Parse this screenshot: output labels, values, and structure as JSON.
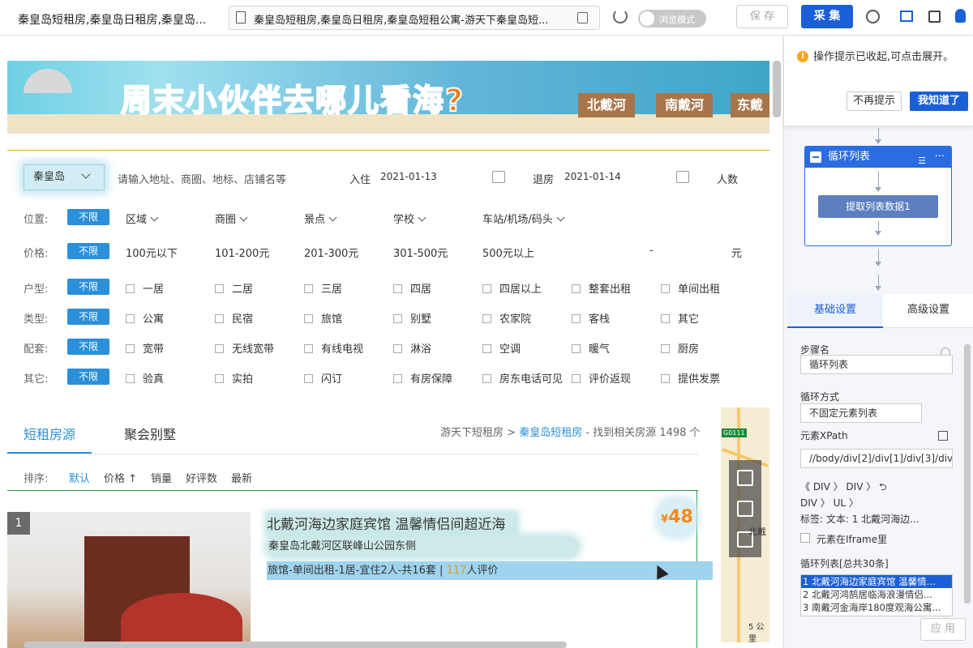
{
  "browser": {
    "tab_title": "秦皇岛短租房,秦皇岛日租房,秦皇岛...",
    "url": "秦皇岛短租房,秦皇岛日租房,秦皇岛短租公寓-游天下秦皇岛短...",
    "browse_mode_label": "浏览模式",
    "save_label": "保 存",
    "collect_label": "采 集"
  },
  "banner": {
    "slogan": "周末小伙伴去哪儿看海?",
    "tags": [
      "北戴河",
      "南戴河",
      "东戴"
    ]
  },
  "search": {
    "city": "秦皇岛",
    "placeholder": "请输入地址、商圈、地标、店铺名等",
    "checkin_label": "入住",
    "checkin_value": "2021-01-13",
    "checkout_label": "退房",
    "checkout_value": "2021-01-14",
    "people_label": "人数"
  },
  "filters": {
    "nolimit": "不限",
    "location": {
      "label": "位置:",
      "opts": [
        "区域",
        "商圈",
        "景点",
        "学校",
        "车站/机场/码头"
      ]
    },
    "price": {
      "label": "价格:",
      "opts": [
        "100元以下",
        "101-200元",
        "201-300元",
        "301-500元",
        "500元以上",
        "-",
        "元"
      ]
    },
    "room": {
      "label": "户型:",
      "opts": [
        "一居",
        "二居",
        "三居",
        "四居",
        "四居以上",
        "整套出租",
        "单间出租"
      ]
    },
    "type": {
      "label": "类型:",
      "opts": [
        "公寓",
        "民宿",
        "旅馆",
        "别墅",
        "农家院",
        "客栈",
        "其它"
      ]
    },
    "facility": {
      "label": "配套:",
      "opts": [
        "宽带",
        "无线宽带",
        "有线电视",
        "淋浴",
        "空调",
        "暖气",
        "厨房"
      ]
    },
    "other": {
      "label": "其它:",
      "opts": [
        "验真",
        "实拍",
        "闪订",
        "有房保障",
        "房东电话可见",
        "评价返现",
        "提供发票"
      ]
    }
  },
  "results": {
    "tab_active": "短租房源",
    "tab_other": "聚会别墅",
    "crumb_home": "游天下短租房",
    "crumb_sep": ">",
    "crumb_city": "秦皇岛短租房",
    "crumb_count": "- 找到相关房源 1498 个",
    "sort_label": "排序:",
    "sort_opts": [
      "默认",
      "价格 ↑",
      "销量",
      "好评数",
      "最新"
    ]
  },
  "listing": {
    "index": "1",
    "title": "北戴河海边家庭宾馆 温馨情侣间超近海",
    "address": "秦皇岛北戴河区联峰山公园东侧",
    "meta_text": "旅馆-单间出租-1居-宜住2人-共16套 |",
    "reviews_count": "117",
    "reviews_label": "人评价",
    "price_currency": "¥",
    "price_value": "48"
  },
  "map": {
    "road_tag": "G0111",
    "place_label": "北戴",
    "scale_label": "5 公里"
  },
  "panel": {
    "tip_message": "操作提示已收起,可点击展开。",
    "tip_dismiss": "不再提示",
    "tip_ok": "我知道了",
    "loop_title": "循环列表",
    "loop_step": "提取列表数据1",
    "tab_basic": "基础设置",
    "tab_advanced": "高级设置",
    "step_name_label": "步骤名",
    "step_name_value": "循环列表",
    "loop_mode_label": "循环方式",
    "loop_mode_value": "不固定元素列表",
    "xpath_label": "元素XPath",
    "xpath_value": "//body/div[2]/div[1]/div[3]/div[",
    "crumb_line1": "《  DIV  〉 DIV  〉 ⮌",
    "crumb_line2": "DIV  〉 UL  〉",
    "crumb_line3": "标签:       文本:  1 北戴河海边...",
    "iframe_label": "元素在Iframe里",
    "loop_list_label": "循环列表[总共30条]",
    "loop_items": [
      "1 北戴河海边家庭宾馆 温馨情...",
      "2 北戴河鸿鹄居临海浪漫情侣...",
      "3 南戴河金海岸180度观海公寓..."
    ],
    "apply_label": "应 用"
  }
}
